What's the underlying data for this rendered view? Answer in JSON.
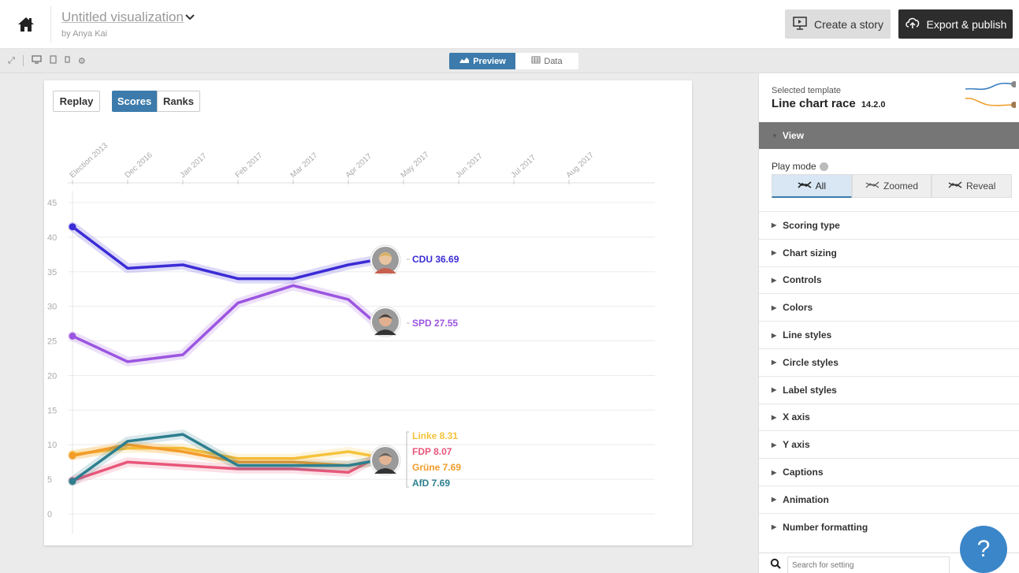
{
  "header": {
    "title": "Untitled visualization",
    "author": "by Anya Kai",
    "create_story": "Create a story",
    "export_publish": "Export & publish"
  },
  "toolbar": {
    "preview_label": "Preview",
    "data_label": "Data"
  },
  "chart_controls": {
    "replay": "Replay",
    "scores": "Scores",
    "ranks": "Ranks"
  },
  "chart_data": {
    "type": "line",
    "x": [
      "Election 2013",
      "Dec 2016",
      "Jan 2017",
      "Feb 2017",
      "Mar 2017",
      "Apr 2017",
      "May 2017",
      "Jun 2017",
      "Jul 2017",
      "Aug 2017"
    ],
    "yticks": [
      0,
      5,
      10,
      15,
      20,
      25,
      30,
      35,
      40,
      45
    ],
    "ylim": [
      0,
      45
    ],
    "series": [
      {
        "name": "CDU",
        "label": "CDU 36.69",
        "color": "#3b2cd6",
        "values": [
          41.5,
          35.5,
          36,
          34,
          34,
          36,
          36.69
        ]
      },
      {
        "name": "SPD",
        "label": "SPD 27.55",
        "color": "#9b55e0",
        "values": [
          25.7,
          22,
          23,
          30.5,
          33,
          31,
          27.55
        ]
      },
      {
        "name": "Linke",
        "label": "Linke 8.31",
        "color": "#f5c33b",
        "values": [
          8.6,
          9.5,
          9.5,
          8,
          8,
          9,
          8.31
        ]
      },
      {
        "name": "FDP",
        "label": "FDP 8.07",
        "color": "#e8577a",
        "values": [
          4.8,
          7.5,
          7,
          6.5,
          6.5,
          6,
          8.07
        ]
      },
      {
        "name": "Grüne",
        "label": "Grüne 7.69",
        "color": "#f39c2a",
        "values": [
          8.4,
          10,
          9,
          7.5,
          7.5,
          7,
          7.69
        ]
      },
      {
        "name": "AfD",
        "label": "AfD 7.69",
        "color": "#2d7f8f",
        "values": [
          4.7,
          10.5,
          11.5,
          7,
          7,
          7,
          7.69
        ]
      }
    ]
  },
  "panel": {
    "template_label": "Selected template",
    "template_name": "Line chart race",
    "template_version": "14.2.0",
    "view_label": "View",
    "play_mode_label": "Play mode",
    "play_modes": [
      "All",
      "Zoomed",
      "Reveal"
    ],
    "sections": [
      "Scoring type",
      "Chart sizing",
      "Controls",
      "Colors",
      "Line styles",
      "Circle styles",
      "Label styles",
      "X axis",
      "Y axis",
      "Captions",
      "Animation",
      "Number formatting"
    ],
    "search_placeholder": "Search for setting"
  },
  "help_label": "?"
}
